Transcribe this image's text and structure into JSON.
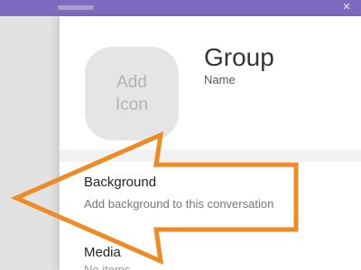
{
  "header": {
    "status_glyph": "✕",
    "title_blur": ""
  },
  "group": {
    "add_icon_label": "Add\nIcon",
    "title": "Group",
    "subtitle": "Name"
  },
  "settings": {
    "background": {
      "title": "Background",
      "subtitle": "Add background to this conversation"
    },
    "media": {
      "title": "Media",
      "subtitle": "No items"
    }
  },
  "annotation": {
    "arrow_color": "#f08a24",
    "arrow_direction": "left"
  },
  "colors": {
    "topbar": "#7d6bbf",
    "panel": "#ffffff",
    "backdrop": "#dcdcdc"
  }
}
